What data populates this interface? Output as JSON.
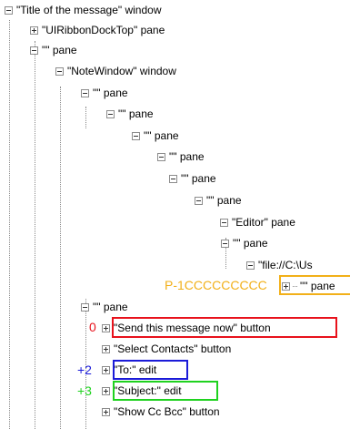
{
  "tree": {
    "nodes": [
      {
        "label": "\"Title of the message\" window",
        "expanded": true
      },
      {
        "label": "\"UIRibbonDockTop\" pane",
        "expanded": false
      },
      {
        "label": "\"\" pane",
        "expanded": true
      },
      {
        "label": "\"NoteWindow\" window",
        "expanded": true
      },
      {
        "label": "\"\" pane",
        "expanded": true
      },
      {
        "label": "\"\" pane",
        "expanded": true
      },
      {
        "label": "\"\" pane",
        "expanded": true
      },
      {
        "label": "\"\" pane",
        "expanded": true
      },
      {
        "label": "\"\" pane",
        "expanded": true
      },
      {
        "label": "\"\" pane",
        "expanded": true
      },
      {
        "label": "\"Editor\" pane",
        "expanded": true
      },
      {
        "label": "\"\" pane",
        "expanded": true
      },
      {
        "label": "\"file://C:\\Us",
        "expanded": true
      },
      {
        "label": "\"\" pane",
        "expanded": false
      },
      {
        "label": "\"\" pane",
        "expanded": true
      },
      {
        "label": "\"Send this message now\" button",
        "expanded": false
      },
      {
        "label": "\"Select Contacts\" button",
        "expanded": false
      },
      {
        "label": "\"To:\" edit",
        "expanded": false
      },
      {
        "label": "\"Subject:\" edit",
        "expanded": false
      },
      {
        "label": "\"Show Cc  Bcc\" button",
        "expanded": false
      }
    ]
  },
  "annotations": {
    "orange": "P-1CCCCCCCCC",
    "red": "0",
    "blue": "+2",
    "green": "+3"
  },
  "colors": {
    "red": "#e8121c",
    "blue": "#1b1bd8",
    "green": "#1fd21f",
    "orange": "#f2b019",
    "tree_line": "#8a8a8a"
  }
}
